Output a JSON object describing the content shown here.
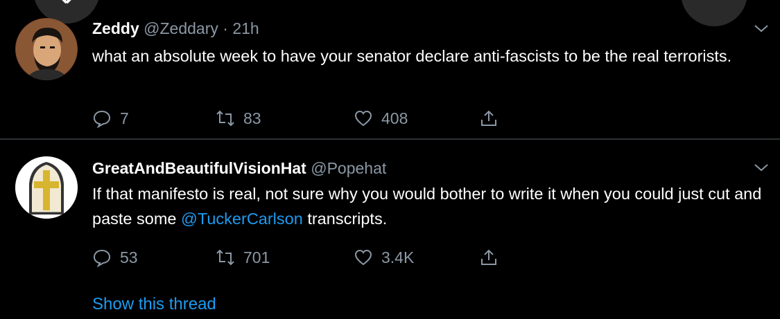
{
  "tweets": [
    {
      "name": "Zeddy",
      "handle": "@Zeddary",
      "dot": "·",
      "time": "21h",
      "text": "what an absolute week to have your senator declare anti-fascists to be the real terrorists.",
      "replies": "7",
      "retweets": "83",
      "likes": "408"
    },
    {
      "name": "GreatAndBeautifulVisionHat",
      "handle": "@Popehat",
      "text_before": "If that manifesto is real, not sure why you would bother to write it when you could just cut and paste some ",
      "mention": "@TuckerCarlson",
      "text_after": " transcripts.",
      "replies": "53",
      "retweets": "701",
      "likes": "3.4K",
      "show_thread": "Show this thread"
    }
  ],
  "colors": {
    "background": "#000000",
    "link": "#1d9bf0",
    "muted": "#8b98a5"
  },
  "icons": [
    "reply-icon",
    "retweet-icon",
    "like-icon",
    "share-icon",
    "chevron-down-icon",
    "close-icon"
  ]
}
